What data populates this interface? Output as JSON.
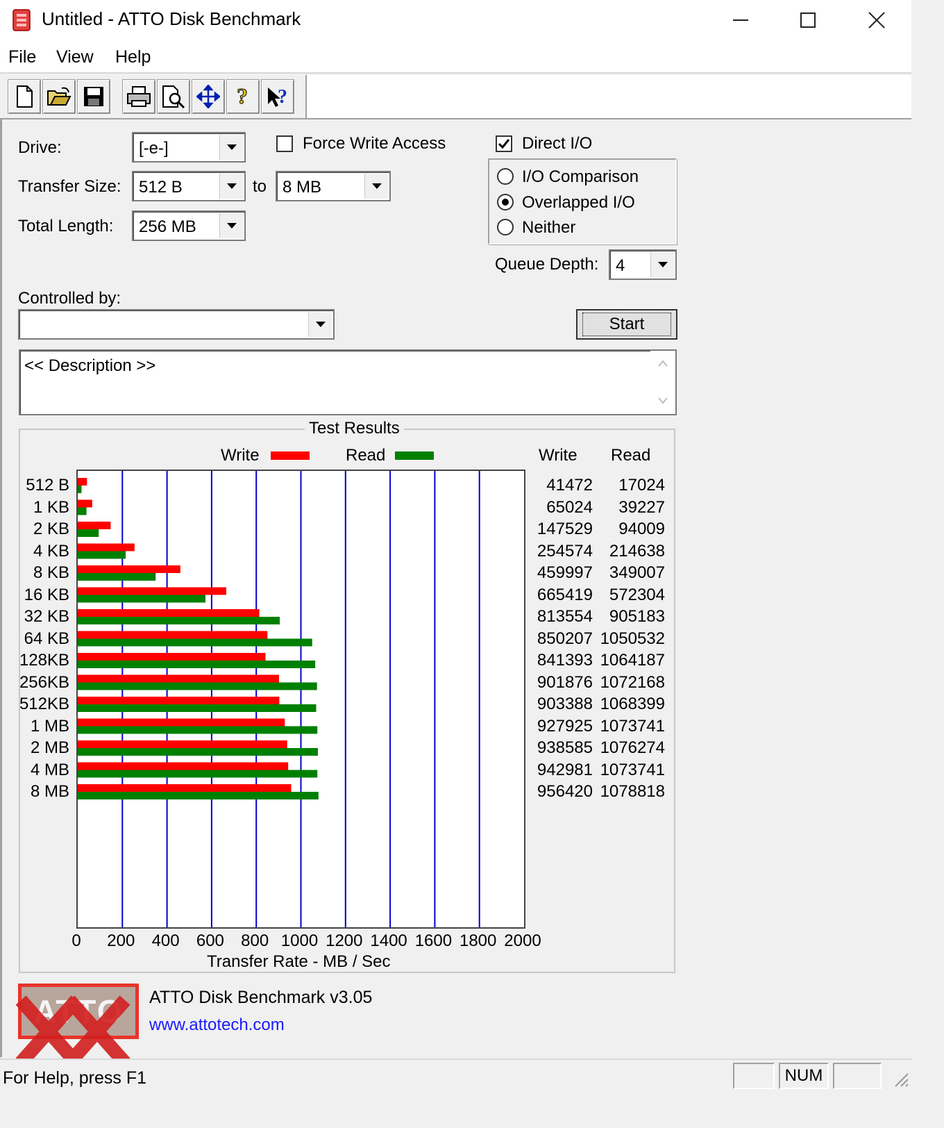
{
  "window": {
    "title": "Untitled - ATTO Disk Benchmark",
    "icon": "app-icon",
    "controls": {
      "minimize": "minimize-icon",
      "maximize": "maximize-icon",
      "close": "close-icon"
    }
  },
  "menu": {
    "items": [
      "File",
      "View",
      "Help"
    ]
  },
  "toolbar": {
    "buttons": [
      "new-icon",
      "open-icon",
      "save-icon",
      "print-icon",
      "print-preview-icon",
      "move-icon",
      "help-icon",
      "context-help-icon"
    ]
  },
  "settings": {
    "drive_label": "Drive:",
    "drive_value": "[-e-]",
    "transfer_size_label": "Transfer Size:",
    "transfer_from": "512 B",
    "to_label": "to",
    "transfer_to": "8 MB",
    "total_length_label": "Total Length:",
    "total_length_value": "256 MB",
    "force_write_label": "Force Write Access",
    "force_write_checked": false,
    "direct_io_label": "Direct I/O",
    "direct_io_checked": true,
    "io_comparison_label": "I/O Comparison",
    "overlapped_label": "Overlapped I/O",
    "neither_label": "Neither",
    "selected_mode": "Overlapped I/O",
    "queue_depth_label": "Queue Depth:",
    "queue_depth_value": "4",
    "controlled_by_label": "Controlled by:",
    "controlled_by_value": "",
    "start_label": "Start",
    "description": "<< Description >>"
  },
  "results": {
    "group_title": "Test Results",
    "write_header": "Write",
    "read_header": "Read"
  },
  "chart_data": {
    "type": "bar",
    "orientation": "horizontal",
    "categories": [
      "512 B",
      "1 KB",
      "2 KB",
      "4 KB",
      "8 KB",
      "16 KB",
      "32 KB",
      "64 KB",
      "128KB",
      "256KB",
      "512KB",
      "1 MB",
      "2 MB",
      "4 MB",
      "8 MB"
    ],
    "series": [
      {
        "name": "Write",
        "color": "#ff0000",
        "values": [
          41472,
          65024,
          147529,
          254574,
          459997,
          665419,
          813554,
          850207,
          841393,
          901876,
          903388,
          927925,
          938585,
          942981,
          956420
        ]
      },
      {
        "name": "Read",
        "color": "#008000",
        "values": [
          17024,
          39227,
          94009,
          214638,
          349007,
          572304,
          905183,
          1050532,
          1064187,
          1072168,
          1068399,
          1073741,
          1076274,
          1073741,
          1078818
        ]
      }
    ],
    "value_unit_displayed": "KB/s",
    "xlabel": "Transfer Rate - MB / Sec",
    "xlim": [
      0,
      2000
    ],
    "xticks": [
      0,
      200,
      400,
      600,
      800,
      1000,
      1200,
      1400,
      1600,
      1800,
      2000
    ],
    "grid": true,
    "grid_color": "#0000cc",
    "legend": "top"
  },
  "footer": {
    "logo_text": "ATTO",
    "version": "ATTO Disk Benchmark v3.05",
    "website": "www.attotech.com"
  },
  "status": {
    "help_text": "For Help, press F1",
    "num_indicator": "NUM"
  }
}
